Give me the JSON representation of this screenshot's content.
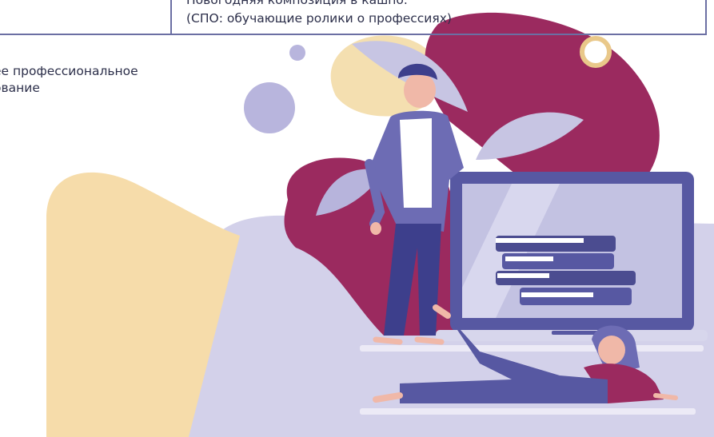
{
  "table": {
    "row_line_1": "Новогодняя композиция в кашпо.",
    "row_line_2": "(СПО: обучающие ролики о профессиях)"
  },
  "category": {
    "line_1": "ее профессиональное",
    "line_2": "ование"
  },
  "colors": {
    "border": "#6b6fa3",
    "text": "#2c2f4a",
    "magenta": "#9b2a5f",
    "lavender": "#c9c6e6",
    "peach": "#f6dcaa",
    "purple": "#5a5a9c"
  }
}
